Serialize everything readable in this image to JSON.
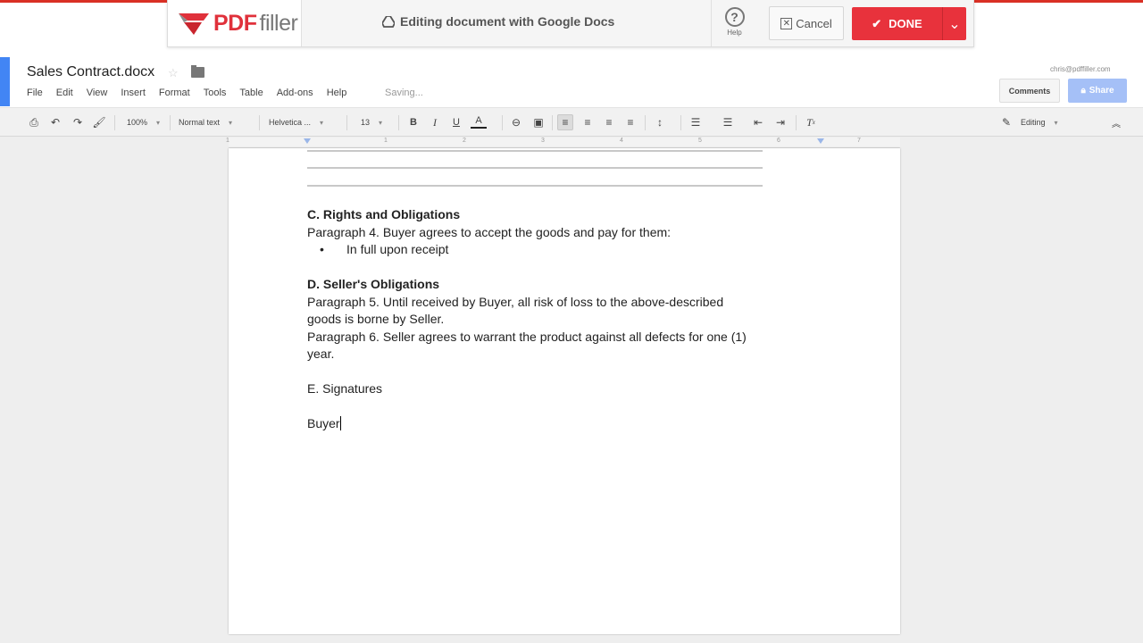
{
  "pdffiller": {
    "logo_main": "PDF",
    "logo_sub": "filler",
    "status": "Editing document with Google Docs",
    "help_label": "Help",
    "cancel_label": "Cancel",
    "done_label": "DONE",
    "accent": "#e8323c"
  },
  "docs": {
    "title": "Sales Contract.docx",
    "menu": [
      "File",
      "Edit",
      "View",
      "Insert",
      "Format",
      "Tools",
      "Table",
      "Add-ons",
      "Help"
    ],
    "status": "Saving...",
    "account": "chris@pdffiller.com",
    "comments_label": "Comments",
    "share_label": "Share"
  },
  "toolbar": {
    "zoom": "100%",
    "style": "Normal text",
    "font": "Helvetica ...",
    "size": "13",
    "mode": "Editing"
  },
  "ruler": {
    "numbers": [
      "1",
      "1",
      "2",
      "3",
      "4",
      "5",
      "6",
      "7"
    ]
  },
  "document": {
    "section_c_heading": "C.  Rights and Obligations",
    "para4": "Paragraph 4.  Buyer agrees to accept the goods and pay for them:",
    "bullet1": "In full upon receipt",
    "section_d_heading": "D.  Seller's Obligations",
    "para5_line1": "Paragraph 5. Until received by Buyer, all risk of loss to the above-described",
    "para5_line2": "goods is borne by Seller.",
    "para6_line1": "Paragraph 6. Seller agrees to warrant the product against all defects for one (1)",
    "para6_line2": "year.",
    "section_e": "E. Signatures",
    "buyer": "Buyer"
  }
}
